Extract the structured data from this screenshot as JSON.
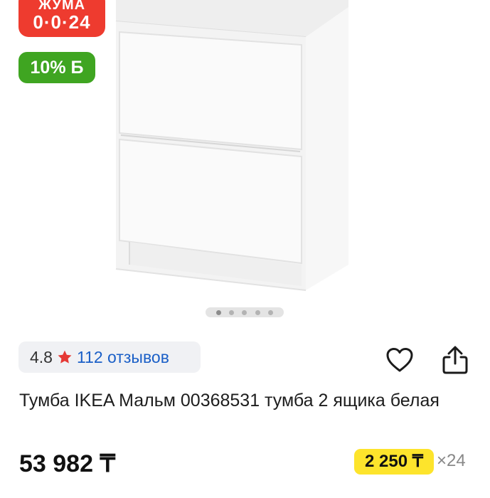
{
  "badges": {
    "promo_line1": "ЖУМА",
    "promo_line2": "0·0·24",
    "bonus": "10% Б"
  },
  "carousel": {
    "total": 5,
    "active_index": 0
  },
  "rating": {
    "value": "4.8",
    "reviews_label": "112 отзывов"
  },
  "product": {
    "title": "Тумба IKEA Мальм 00368531 тумба 2 ящика белая",
    "price": "53 982 ₸"
  },
  "installment": {
    "amount": "2 250 ₸",
    "multiplier": "×24"
  },
  "colors": {
    "promo_red": "#ee3b2f",
    "bonus_green": "#3fa521",
    "link_blue": "#1a5fc7",
    "star_red": "#e53935",
    "installment_yellow": "#fde42c"
  },
  "icons": [
    "star-icon",
    "heart-icon",
    "share-icon"
  ]
}
